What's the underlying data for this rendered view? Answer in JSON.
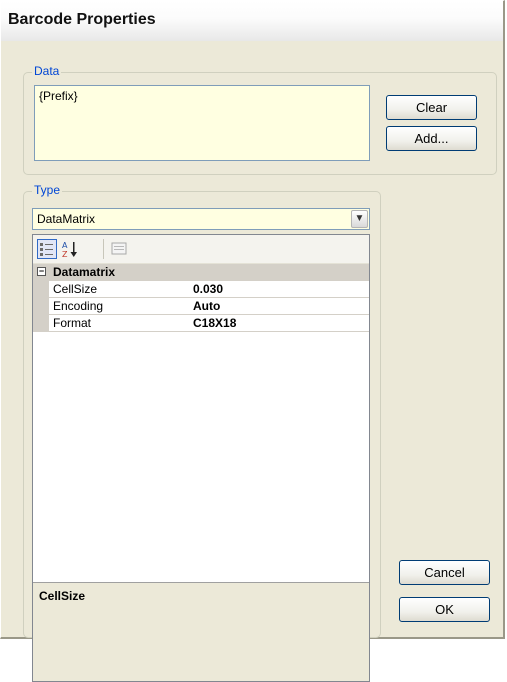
{
  "window": {
    "title": "Barcode Properties"
  },
  "data_group": {
    "legend": "Data",
    "text": "{Prefix}",
    "clear_label": "Clear",
    "add_label": "Add..."
  },
  "type_group": {
    "legend": "Type",
    "selected": "DataMatrix"
  },
  "property_grid": {
    "category": "Datamatrix",
    "properties": [
      {
        "name": "CellSize",
        "value": "0.030"
      },
      {
        "name": "Encoding",
        "value": "Auto"
      },
      {
        "name": "Format",
        "value": "C18X18"
      }
    ],
    "help_title": "CellSize"
  },
  "buttons": {
    "cancel_label": "Cancel",
    "ok_label": "OK"
  },
  "colors": {
    "legend": "#0046d5",
    "data_background": "#ffffe1",
    "dialog_face": "#ece9d8"
  }
}
